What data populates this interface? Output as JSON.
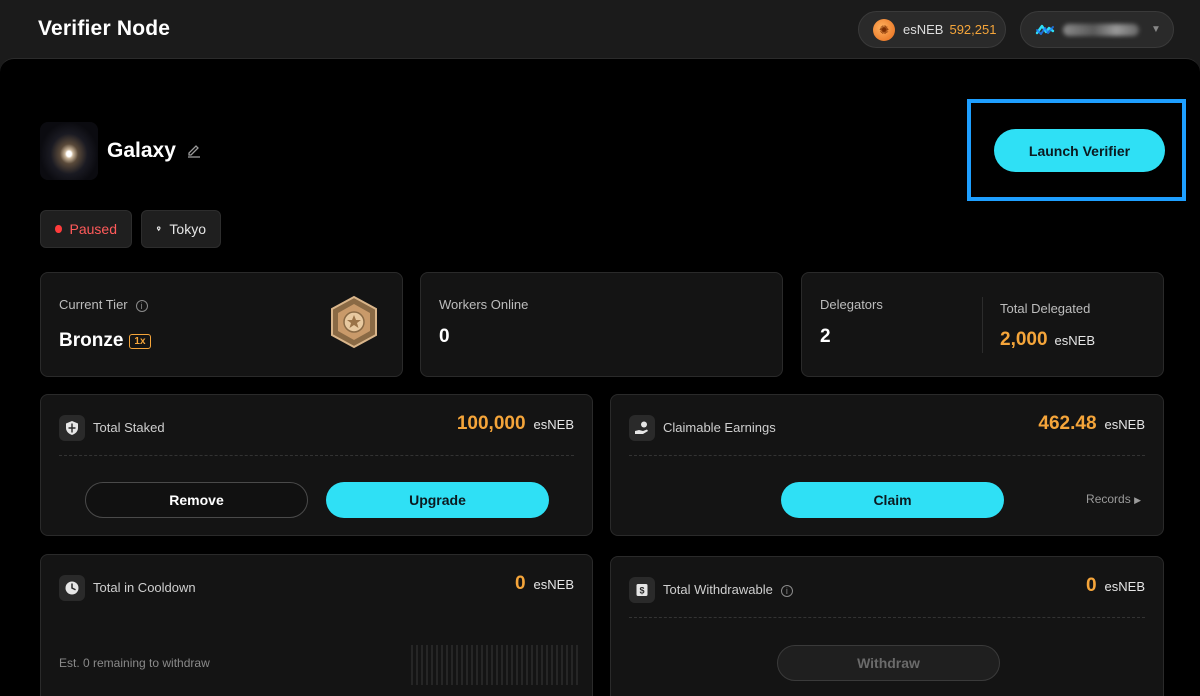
{
  "header": {
    "title": "Verifier Node",
    "balance": {
      "token": "esNEB",
      "amount": "592,251",
      "icon": "esneb-coin-icon"
    },
    "wallet": {
      "network_icon": "network-logo-icon",
      "caret_icon": "chevron-down-icon"
    }
  },
  "node": {
    "name": "Galaxy",
    "edit_icon": "pencil-icon",
    "launch_label": "Launch Verifier",
    "status": "Paused",
    "location": "Tokyo"
  },
  "stats": {
    "tier_label": "Current Tier",
    "tier_value": "Bronze",
    "tier_multiplier": "1x",
    "workers_label": "Workers Online",
    "workers_value": "0",
    "delegators_label": "Delegators",
    "delegators_value": "2",
    "total_delegated_label": "Total Delegated",
    "total_delegated_value": "2,000",
    "total_delegated_unit": "esNEB"
  },
  "staked": {
    "title": "Total Staked",
    "amount": "100,000",
    "unit": "esNEB",
    "remove_label": "Remove",
    "upgrade_label": "Upgrade"
  },
  "earnings": {
    "title": "Claimable Earnings",
    "amount": "462.48",
    "unit": "esNEB",
    "claim_label": "Claim",
    "records_label": "Records"
  },
  "cooldown": {
    "title": "Total in Cooldown",
    "amount": "0",
    "unit": "esNEB",
    "est_text": "Est. 0 remaining to withdraw"
  },
  "withdrawable": {
    "title": "Total Withdrawable",
    "amount": "0",
    "unit": "esNEB",
    "withdraw_label": "Withdraw"
  },
  "colors": {
    "accent": "#2fe0f5",
    "highlight_border": "#1e9fff",
    "amount": "#f5a53a",
    "paused": "#ff5a5a"
  }
}
